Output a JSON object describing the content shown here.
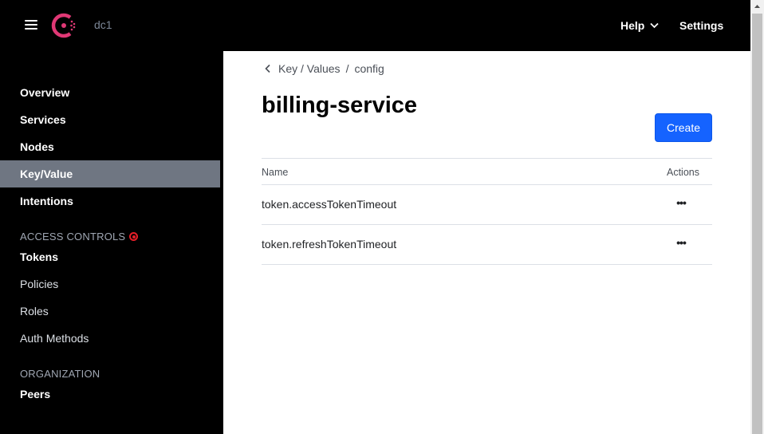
{
  "header": {
    "datacenter": "dc1",
    "help_label": "Help",
    "settings_label": "Settings"
  },
  "sidebar": {
    "items": [
      {
        "label": "Overview"
      },
      {
        "label": "Services"
      },
      {
        "label": "Nodes"
      },
      {
        "label": "Key/Value",
        "active": true
      },
      {
        "label": "Intentions"
      }
    ],
    "access_controls_title": "ACCESS CONTROLS",
    "access_items": [
      {
        "label": "Tokens"
      },
      {
        "label": "Policies"
      },
      {
        "label": "Roles"
      },
      {
        "label": "Auth Methods"
      }
    ],
    "organization_title": "ORGANIZATION",
    "org_items": [
      {
        "label": "Peers"
      }
    ]
  },
  "breadcrumb": {
    "root": "Key / Values",
    "separator": "/",
    "current": "config"
  },
  "page": {
    "title": "billing-service",
    "create_label": "Create"
  },
  "table": {
    "headers": {
      "name": "Name",
      "actions": "Actions"
    },
    "rows": [
      {
        "name": "token.accessTokenTimeout",
        "actions": "•••"
      },
      {
        "name": "token.refreshTokenTimeout",
        "actions": "•••"
      }
    ]
  },
  "colors": {
    "brand": "#e03875",
    "primary_button": "#1563ff",
    "active_nav": "#6f7682",
    "alert": "#e61e28"
  }
}
